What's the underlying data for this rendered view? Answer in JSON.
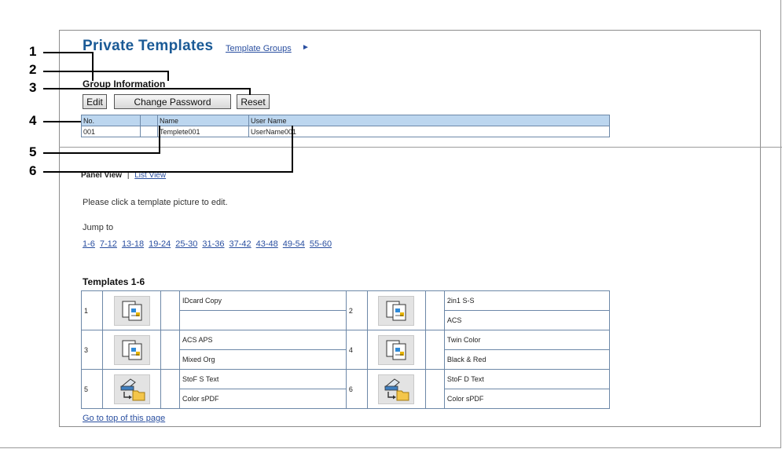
{
  "header": {
    "title": "Private Templates",
    "link_label": "Template Groups",
    "link_arrow": "►"
  },
  "group_info": {
    "heading": "Group Information",
    "buttons": {
      "edit": "Edit",
      "change_password": "Change Password",
      "reset": "Reset"
    },
    "table": {
      "headers": [
        "No.",
        "",
        "Name",
        "User Name"
      ],
      "row": [
        "001",
        "",
        "Templete001",
        "UserName001"
      ]
    }
  },
  "view": {
    "current": "Panel View",
    "separator": "|",
    "other": "List View"
  },
  "instruction": "Please click a template picture to edit.",
  "jump": {
    "label": "Jump to",
    "ranges": [
      "1-6",
      "7-12",
      "13-18",
      "19-24",
      "25-30",
      "31-36",
      "37-42",
      "43-48",
      "49-54",
      "55-60"
    ]
  },
  "templates": {
    "heading": "Templates 1-6",
    "rows": [
      {
        "left": {
          "num": "1",
          "icon": "copy-template-icon",
          "line1": "IDcard Copy",
          "line2": ""
        },
        "right": {
          "num": "2",
          "icon": "copy-template-icon",
          "line1": "2in1 S-S",
          "line2": "ACS"
        }
      },
      {
        "left": {
          "num": "3",
          "icon": "copy-template-icon",
          "line1": "ACS APS",
          "line2": "Mixed Org"
        },
        "right": {
          "num": "4",
          "icon": "copy-template-icon",
          "line1": "Twin Color",
          "line2": "Black & Red"
        }
      },
      {
        "left": {
          "num": "5",
          "icon": "scan-to-file-icon",
          "line1": "StoF S Text",
          "line2": "Color sPDF"
        },
        "right": {
          "num": "6",
          "icon": "scan-to-file-icon",
          "line1": "StoF D Text",
          "line2": "Color sPDF"
        }
      }
    ]
  },
  "footer_link": "Go to top of this page",
  "callouts": [
    "1",
    "2",
    "3",
    "4",
    "5",
    "6"
  ]
}
